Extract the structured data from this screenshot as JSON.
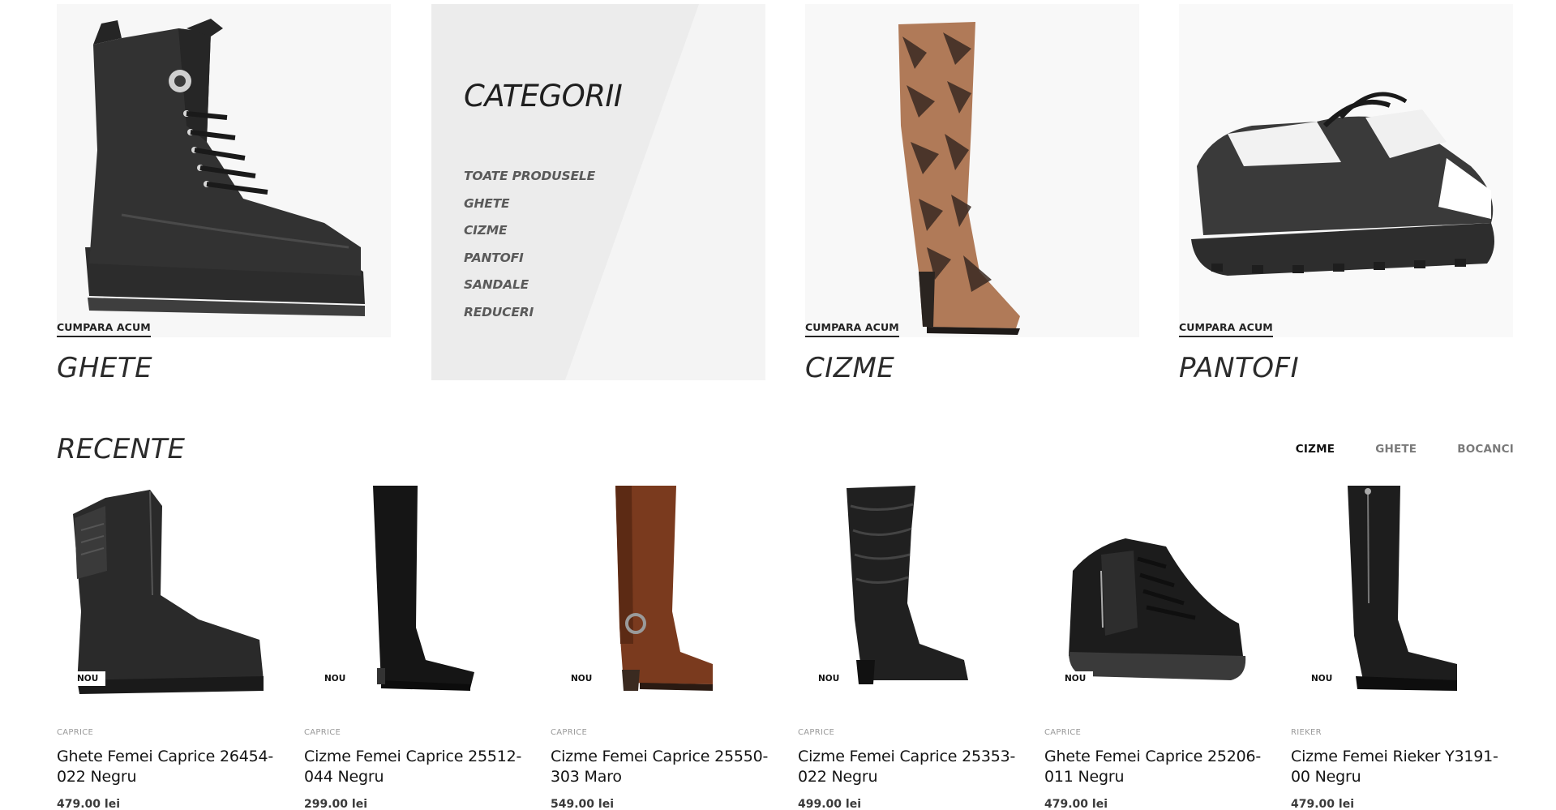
{
  "categories_panel": {
    "heading": "CATEGORII",
    "items": [
      "TOATE PRODUSELE",
      "GHETE",
      "CIZME",
      "PANTOFI",
      "SANDALE",
      "REDUCERI"
    ]
  },
  "tiles": [
    {
      "cta": "CUMPARA ACUM",
      "title": "GHETE"
    },
    {
      "cta": "CUMPARA ACUM",
      "title": "CIZME"
    },
    {
      "cta": "CUMPARA ACUM",
      "title": "PANTOFI"
    }
  ],
  "recent": {
    "title": "RECENTE",
    "filters": [
      "CIZME",
      "GHETE",
      "BOCANCI"
    ],
    "active_filter": "CIZME"
  },
  "products": [
    {
      "badge": "NOU",
      "brand": "CAPRICE",
      "name": "Ghete Femei Caprice 26454-022 Negru",
      "price": "479.00 lei"
    },
    {
      "badge": "NOU",
      "brand": "CAPRICE",
      "name": "Cizme Femei Caprice 25512-044 Negru",
      "price": "299.00 lei"
    },
    {
      "badge": "NOU",
      "brand": "CAPRICE",
      "name": "Cizme Femei Caprice 25550-303 Maro",
      "price": "549.00 lei"
    },
    {
      "badge": "NOU",
      "brand": "CAPRICE",
      "name": "Cizme Femei Caprice 25353-022 Negru",
      "price": "499.00 lei"
    },
    {
      "badge": "NOU",
      "brand": "CAPRICE",
      "name": "Ghete Femei Caprice 25206-011 Negru",
      "price": "479.00 lei"
    },
    {
      "badge": "NOU",
      "brand": "RIEKER",
      "name": "Cizme Femei Rieker Y3191-00 Negru",
      "price": "479.00 lei"
    }
  ],
  "colors": {
    "text_dark": "#1a1a1a",
    "panel_bg": "#f1f1f1",
    "boot_black": "#2a2a2a",
    "boot_brown": "#7a3a1e",
    "snake_tan": "#b07a58"
  }
}
